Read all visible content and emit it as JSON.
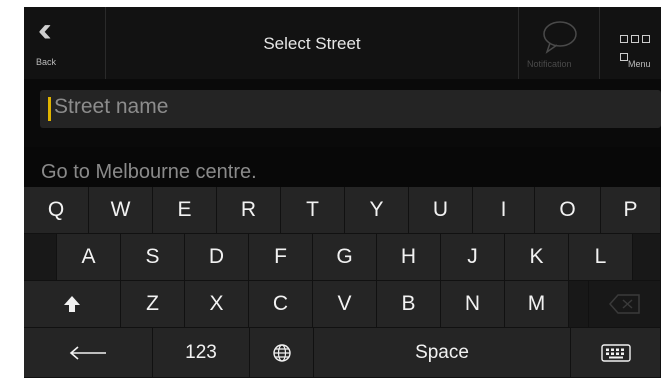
{
  "header": {
    "back_label": "Back",
    "title": "Select Street",
    "notification_label": "Notification",
    "menu_label": "Menu"
  },
  "search": {
    "placeholder": "Street name",
    "value": ""
  },
  "suggestion": {
    "text": "Go to Melbourne centre."
  },
  "keyboard": {
    "row1": [
      "Q",
      "W",
      "E",
      "R",
      "T",
      "Y",
      "U",
      "I",
      "O",
      "P"
    ],
    "row2": [
      "A",
      "S",
      "D",
      "F",
      "G",
      "H",
      "J",
      "K",
      "L"
    ],
    "row3": [
      "Z",
      "X",
      "C",
      "V",
      "B",
      "N",
      "M"
    ],
    "numbers_label": "123",
    "space_label": "Space",
    "shift_icon": "shift-arrow-icon",
    "backspace_icon": "backspace-icon",
    "left_arrow_icon": "left-arrow-icon",
    "globe_icon": "globe-icon",
    "hide_keyboard_icon": "keyboard-icon"
  },
  "colors": {
    "background": "#0a0a0a",
    "cursor": "#e0b400"
  }
}
